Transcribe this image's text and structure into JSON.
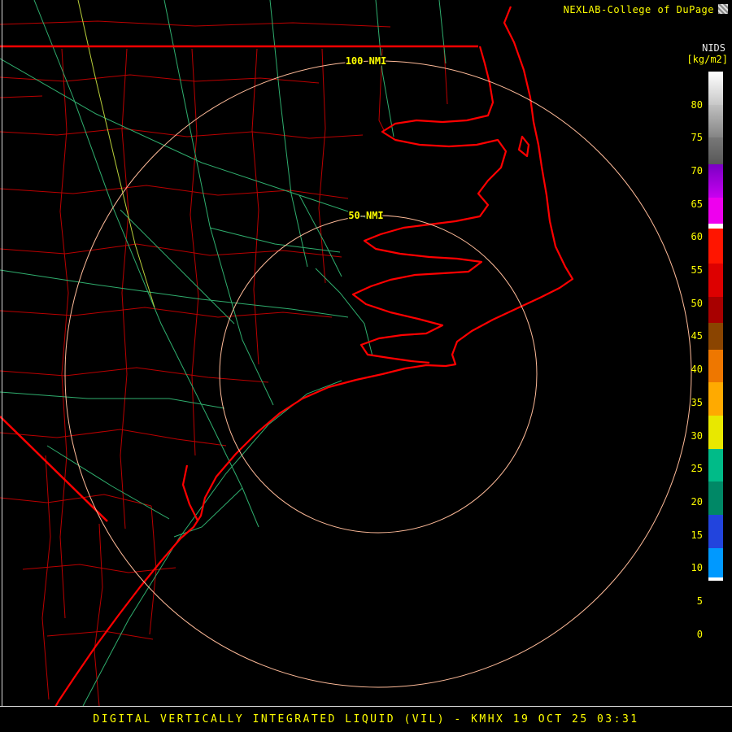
{
  "header": {
    "brand": "NEXLAB-College of DuPage"
  },
  "colorbar": {
    "product": "NIDS",
    "units": "[kg/m2]",
    "ticks": [
      80,
      75,
      70,
      65,
      60,
      55,
      50,
      45,
      40,
      35,
      30,
      25,
      20,
      15,
      10,
      5,
      0
    ],
    "scale": {
      "top_value": 85,
      "bottom_value": -2.5
    },
    "segments": [
      {
        "from": 85,
        "to": 80,
        "color": "#ffffff",
        "color2": "#c8c8c8"
      },
      {
        "from": 80,
        "to": 75,
        "color": "#c0c0c0",
        "color2": "#858585"
      },
      {
        "from": 75,
        "to": 71,
        "color": "#787878",
        "color2": "#585858"
      },
      {
        "from": 71,
        "to": 66,
        "color": "#7a00c4",
        "color2": "#c800f0"
      },
      {
        "from": 66,
        "to": 62,
        "color": "#ee00ee"
      },
      {
        "from": 62,
        "to": 61.3,
        "color": "#ffffff"
      },
      {
        "from": 61.3,
        "to": 56,
        "color": "#ff1500"
      },
      {
        "from": 56,
        "to": 51,
        "color": "#dd0000"
      },
      {
        "from": 51,
        "to": 47,
        "color": "#a80000"
      },
      {
        "from": 47,
        "to": 43,
        "color": "#8a4400"
      },
      {
        "from": 43,
        "to": 38,
        "color": "#ee7700"
      },
      {
        "from": 38,
        "to": 33,
        "color": "#ffaa00"
      },
      {
        "from": 33,
        "to": 28,
        "color": "#e8e800"
      },
      {
        "from": 28,
        "to": 23,
        "color": "#00bb88"
      },
      {
        "from": 23,
        "to": 18,
        "color": "#008866"
      },
      {
        "from": 18,
        "to": 13,
        "color": "#2244dd"
      },
      {
        "from": 13,
        "to": 8.5,
        "color": "#0099ff"
      },
      {
        "from": 8.5,
        "to": 8,
        "color": "#ffffff"
      },
      {
        "from": 8,
        "to": -2.5,
        "color": "#000000"
      }
    ]
  },
  "map": {
    "ring_labels": {
      "outer": "100 NMI",
      "inner": "50 NMI"
    },
    "radar_site": "KMHX"
  },
  "footer": {
    "title": "DIGITAL VERTICALLY INTEGRATED LIQUID (VIL) - KMHX 19 OCT 25 03:31"
  },
  "colors": {
    "coast": "#ff0000",
    "county": "#bb0000",
    "road": "#2fae6e",
    "road_alt": "#b9cf3a",
    "ring": "#ffbb99",
    "map_label": "#ffff00",
    "accent_text": "#ffff00"
  }
}
